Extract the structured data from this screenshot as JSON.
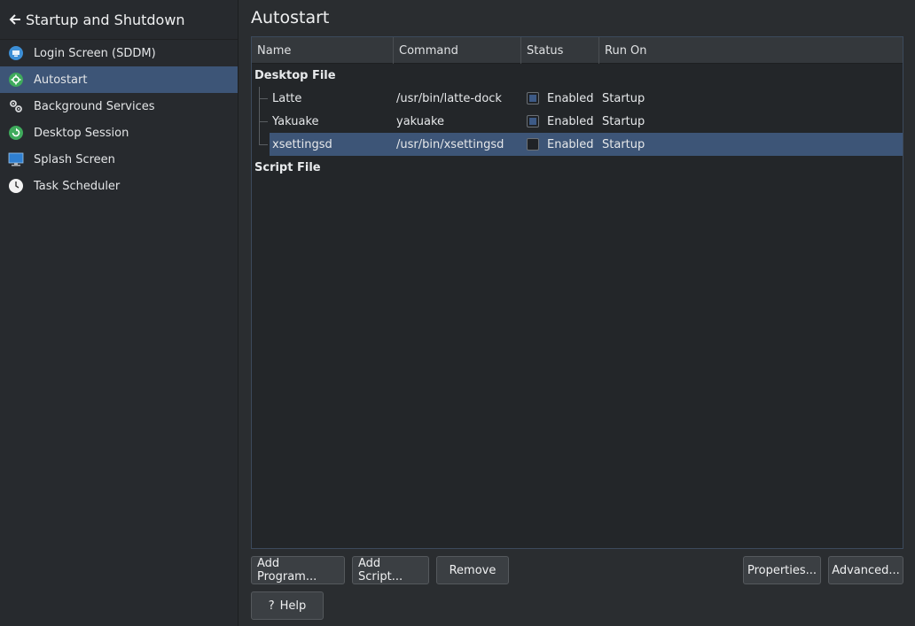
{
  "sidebar": {
    "title": "Startup and Shutdown",
    "items": [
      {
        "label": "Login Screen (SDDM)",
        "icon": "login-screen-icon"
      },
      {
        "label": "Autostart",
        "icon": "autostart-gear-icon",
        "active": true
      },
      {
        "label": "Background Services",
        "icon": "services-gears-icon"
      },
      {
        "label": "Desktop Session",
        "icon": "session-icon"
      },
      {
        "label": "Splash Screen",
        "icon": "monitor-icon"
      },
      {
        "label": "Task Scheduler",
        "icon": "clock-icon"
      }
    ]
  },
  "main": {
    "title": "Autostart",
    "columns": [
      "Name",
      "Command",
      "Status",
      "Run On"
    ],
    "groups": [
      {
        "label": "Desktop File",
        "rows": [
          {
            "name": "Latte",
            "command": "/usr/bin/latte-dock",
            "checked": true,
            "status": "Enabled",
            "run_on": "Startup"
          },
          {
            "name": "Yakuake",
            "command": "yakuake",
            "checked": true,
            "status": "Enabled",
            "run_on": "Startup"
          },
          {
            "name": "xsettingsd",
            "command": "/usr/bin/xsettingsd",
            "checked": false,
            "status": "Enabled",
            "run_on": "Startup",
            "selected": true
          }
        ]
      },
      {
        "label": "Script File",
        "rows": []
      }
    ],
    "buttons": {
      "add_program": "Add Program...",
      "add_script": "Add Script...",
      "remove": "Remove",
      "properties": "Properties...",
      "advanced": "Advanced...",
      "help": "Help"
    }
  },
  "colors": {
    "accent": "#3d5577",
    "background": "#2a2d30",
    "table_bg": "#232629"
  }
}
